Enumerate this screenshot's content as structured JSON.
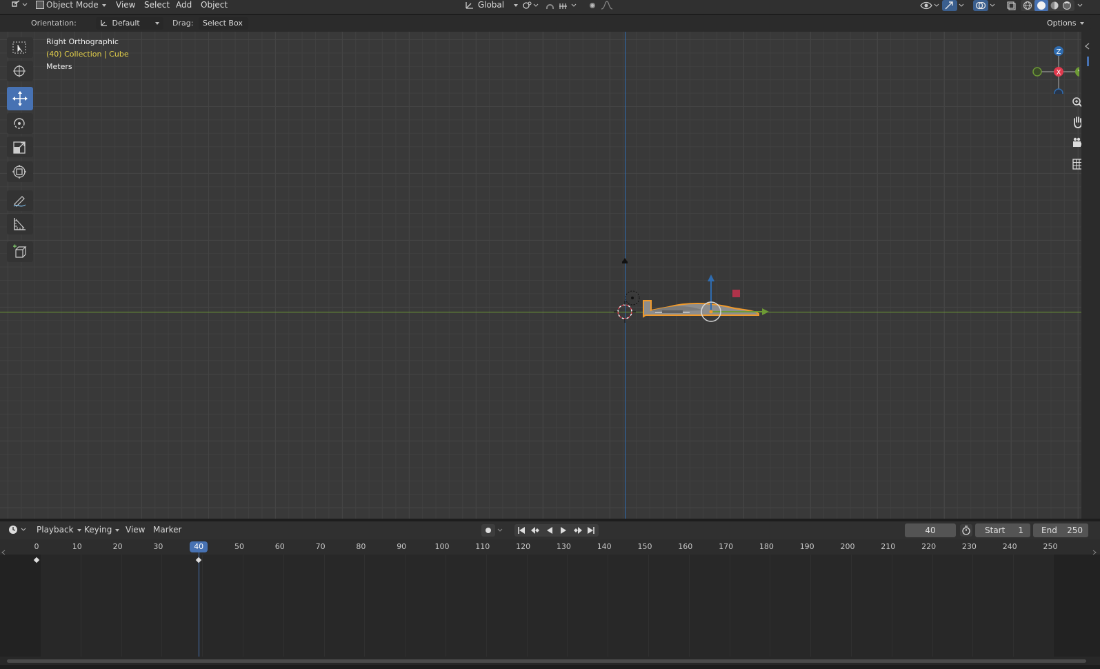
{
  "header": {
    "editor_type": "3d-viewport-editor-icon",
    "mode": "Object Mode",
    "menus": [
      "View",
      "Select",
      "Add",
      "Object"
    ],
    "transform_orientation": "Global"
  },
  "tool_settings": {
    "orientation_label": "Orientation:",
    "orientation_value": "Default",
    "drag_label": "Drag:",
    "drag_value": "Select Box",
    "options_label": "Options"
  },
  "viewport": {
    "view_name": "Right Orthographic",
    "collection_info": "(40) Collection | Cube",
    "units": "Meters",
    "gizmo_axes": {
      "z": "Z",
      "x": "X",
      "y": "Y"
    },
    "colors": {
      "z_axis": "#2f6cb0",
      "y_axis": "#6d9a35",
      "x_axis": "#e0394d",
      "selection": "#f09a2c",
      "active_tool": "#4772b3"
    }
  },
  "timeline": {
    "menus": [
      "Playback",
      "Keying",
      "View",
      "Marker"
    ],
    "current_frame": "40",
    "start_label": "Start",
    "start_value": "1",
    "end_label": "End",
    "end_value": "250",
    "ruler_ticks": [
      "0",
      "10",
      "20",
      "30",
      "40",
      "50",
      "60",
      "70",
      "80",
      "90",
      "100",
      "110",
      "120",
      "130",
      "140",
      "150",
      "160",
      "170",
      "180",
      "190",
      "200",
      "210",
      "220",
      "230",
      "240",
      "250"
    ],
    "keyframes": [
      0,
      40
    ]
  }
}
